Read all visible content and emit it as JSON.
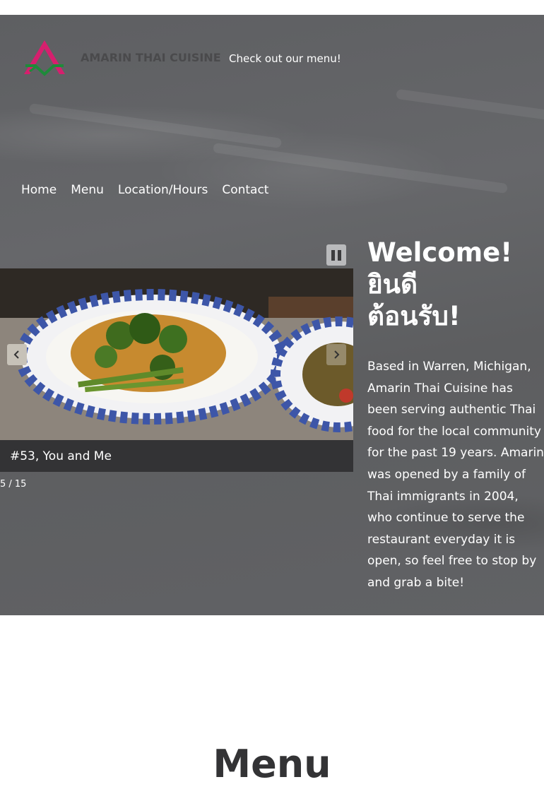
{
  "header": {
    "brand": "AMARIN THAI CUISINE",
    "menu_link": "Check out our menu!"
  },
  "nav": {
    "items": [
      "Home",
      "Menu",
      "Location/Hours",
      "Contact"
    ]
  },
  "slideshow": {
    "caption": "#53, You and Me",
    "counter": "5 / 15"
  },
  "welcome": {
    "title_line1": "Welcome!",
    "title_line2": "ยินดี",
    "title_line3": "ต้อนรับ!",
    "body": "Based in Warren, Michigan, Amarin Thai Cuisine has been serving authentic Thai food for the local community for the past 19 years. Amarin was opened by a family of Thai immigrants in 2004, who continue to serve the restaurant everyday it is open, so feel free to stop by and grab a bite!"
  },
  "menu_section": {
    "heading": "Menu"
  },
  "colors": {
    "hero_overlay": "#5f6063",
    "caption_bg": "#333335",
    "logo_pink": "#d61f6e",
    "logo_green": "#1f8a3a",
    "brand_text": "#4a4a4c"
  }
}
